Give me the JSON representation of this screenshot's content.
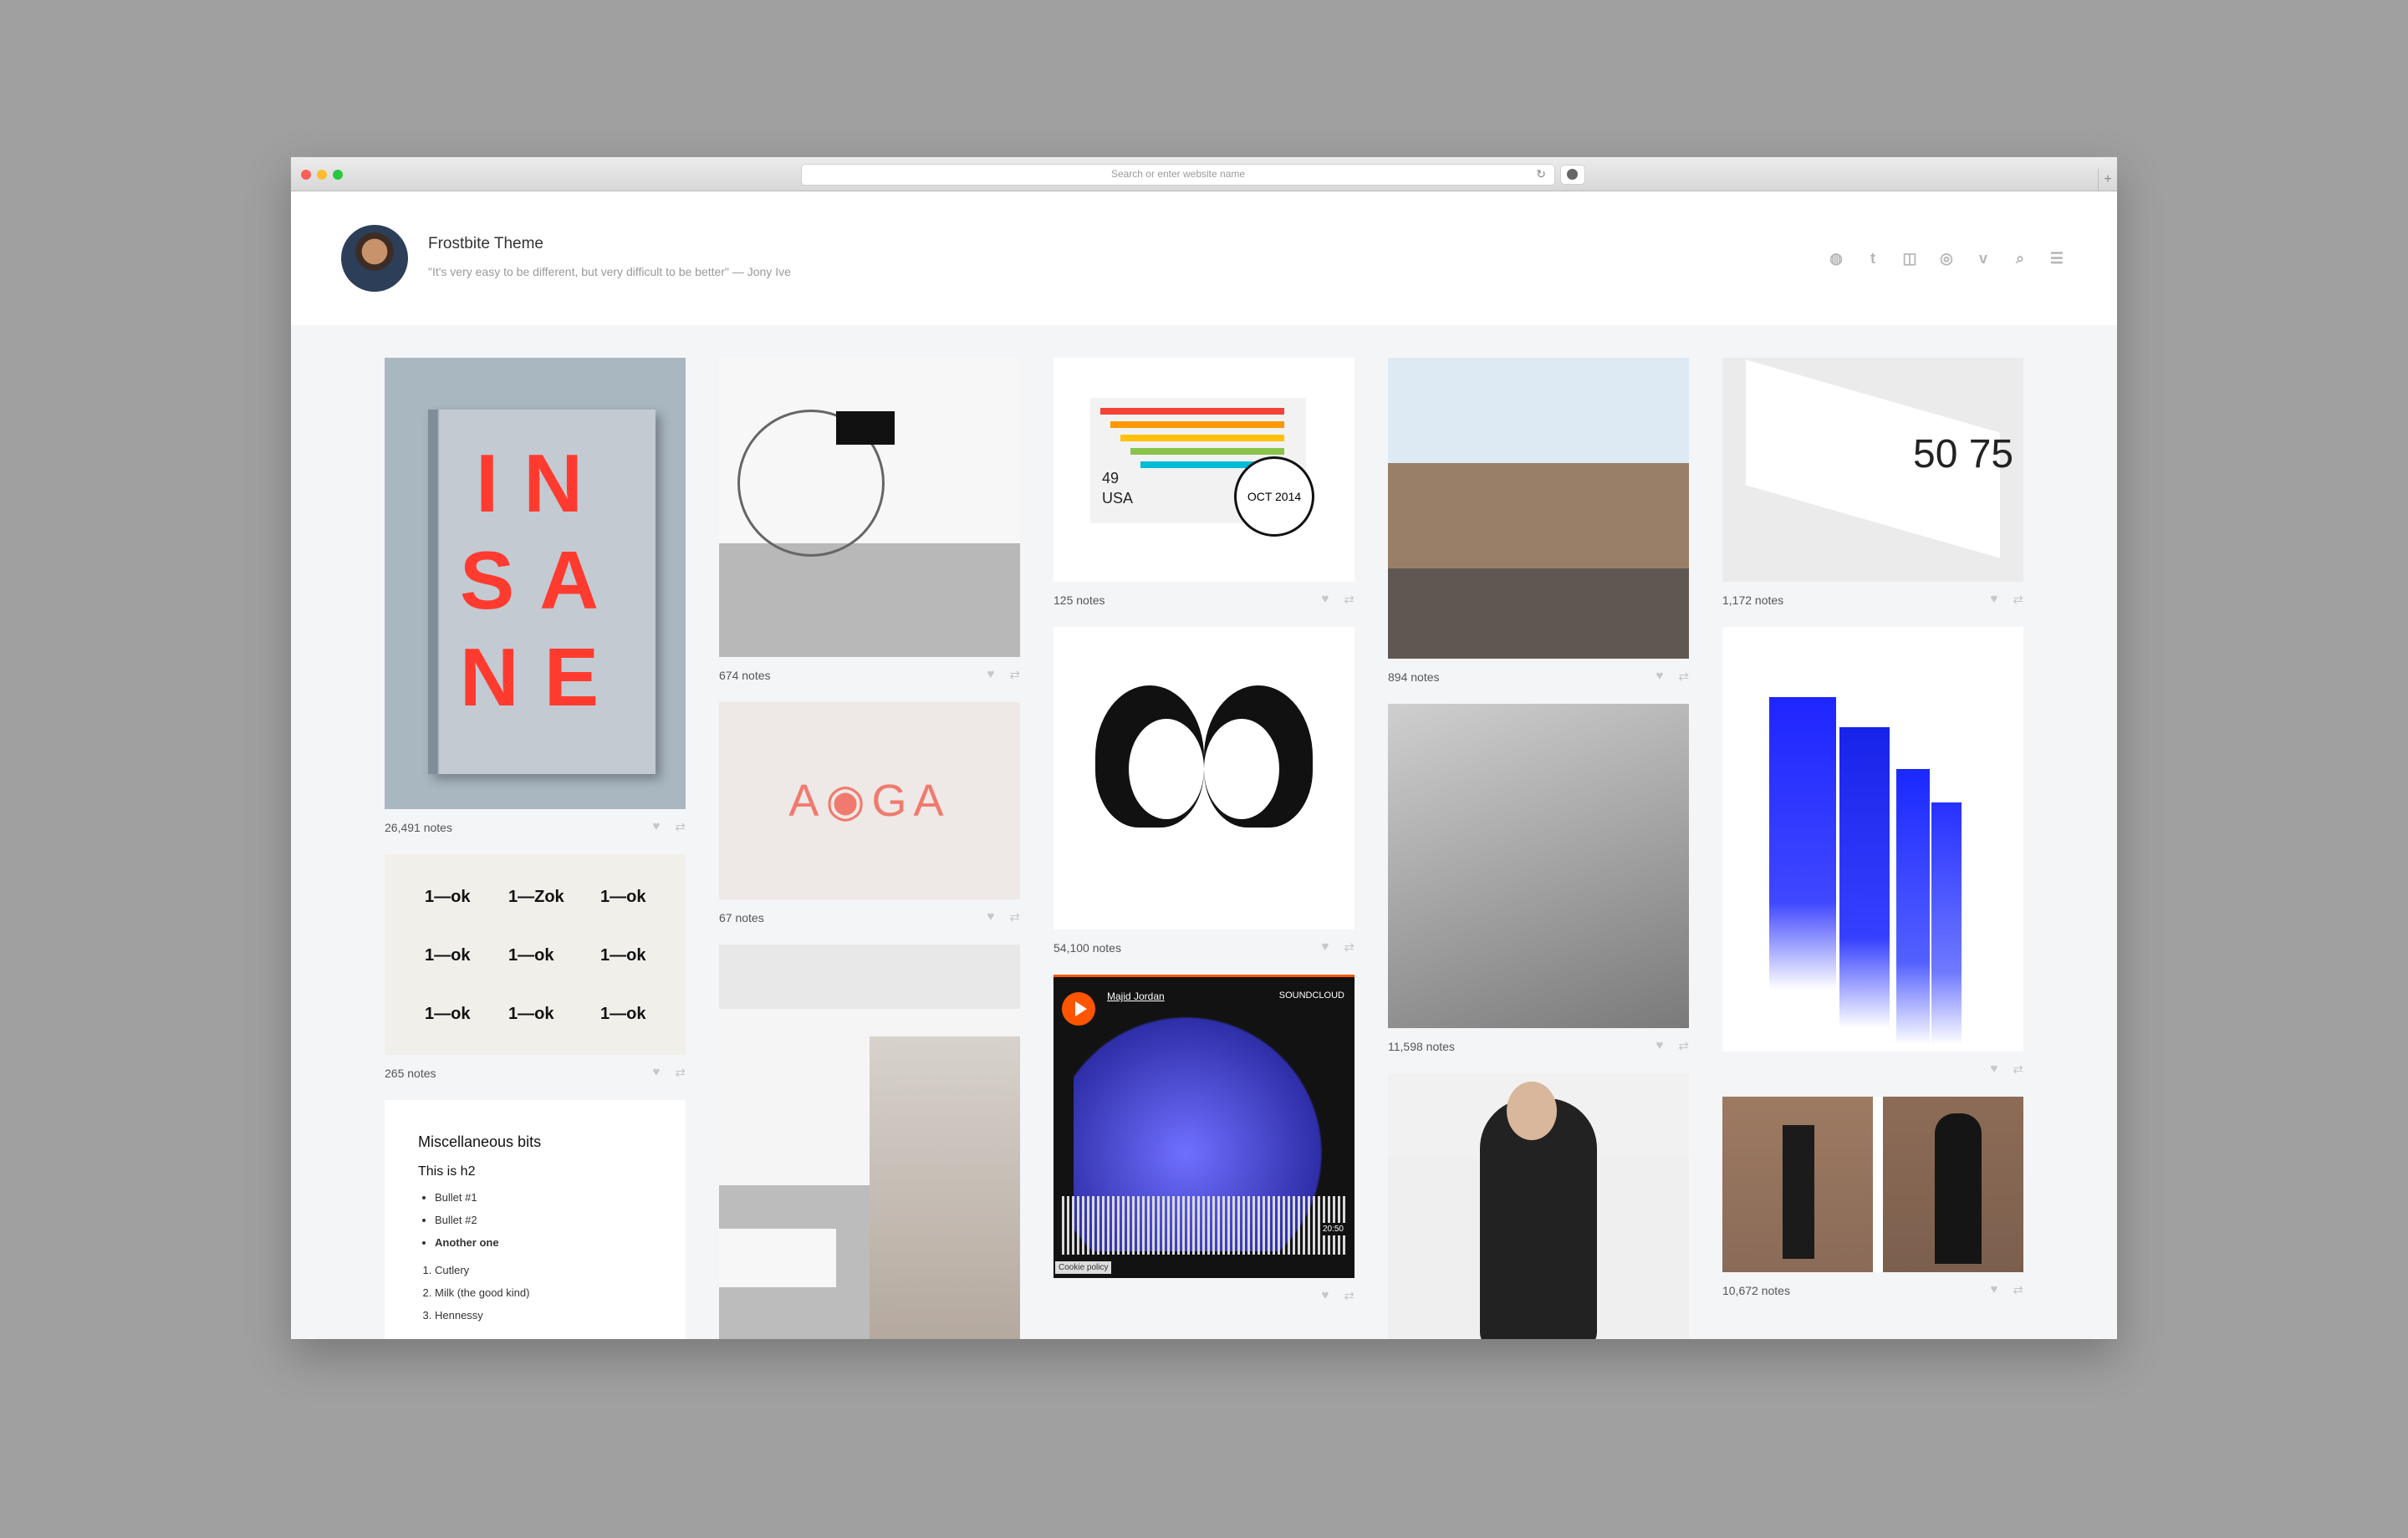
{
  "browser": {
    "address_placeholder": "Search or enter website name"
  },
  "header": {
    "title": "Frostbite Theme",
    "quote": "\"It's very easy to be different, but very difficult to be better\" — Jony Ive"
  },
  "social_icons": [
    "globe-icon",
    "twitter-icon",
    "instagram-icon",
    "dribbble-icon",
    "vimeo-icon",
    "search-icon",
    "menu-icon"
  ],
  "posts": {
    "insane": {
      "notes": "26,491 notes",
      "text": "IN SA NE"
    },
    "ok": {
      "notes": "265 notes",
      "glyphs": [
        "1—ok",
        "1—Zok",
        "1—ok",
        "1—ok",
        "1—ok",
        "1—ok",
        "1—ok",
        "1—ok",
        "1—ok"
      ]
    },
    "misc": {
      "title": "Miscellaneous bits",
      "h2": "This is h2",
      "bullets": [
        "Bullet #1",
        "Bullet #2",
        "Another one"
      ],
      "ordered": [
        "Cutlery",
        "Milk (the good kind)",
        "Hennessy"
      ]
    },
    "bike": {
      "notes": "674 notes"
    },
    "aoga": {
      "notes": "67 notes",
      "text": "A◉GA"
    },
    "stamp": {
      "notes": "125 notes",
      "left": "49",
      "usa": "USA",
      "seal": "OCT 2014"
    },
    "girls": {
      "notes": "54,100 notes"
    },
    "sound": {
      "artist": "Majid Jordan",
      "brand": "SOUNDCLOUD",
      "time": "20:50",
      "cookie": "Cookie policy"
    },
    "mountain": {
      "notes": "894 notes"
    },
    "bw": {
      "notes": "11,598 notes"
    },
    "spread": {
      "notes": "1,172 notes",
      "numbers": "50 75"
    },
    "pair": {
      "notes": "10,672 notes"
    }
  }
}
